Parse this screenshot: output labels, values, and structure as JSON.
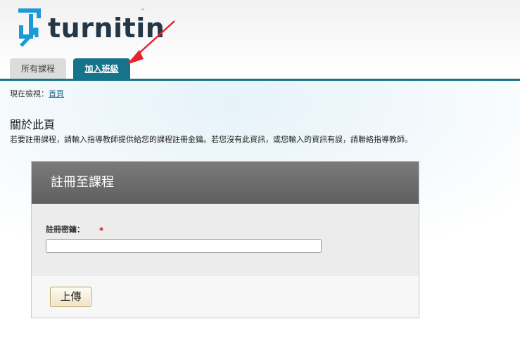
{
  "brand": {
    "logo_text": "turnitin",
    "trademark": "™",
    "primary_color": "#16748a",
    "logo_mark_color": "#1a9ad6"
  },
  "tabs": [
    {
      "label": "所有課程",
      "active": false
    },
    {
      "label": "加入班級",
      "active": true
    }
  ],
  "breadcrumb": {
    "prefix": "現在檢視：",
    "link": "首頁"
  },
  "about": {
    "title": "關於此頁",
    "description": "若要註冊課程，請輸入指導教師提供給您的課程註冊金鑰。若您沒有此資訊，或您輸入的資訊有誤，請聯絡指導教師。"
  },
  "form": {
    "title": "註冊至課程",
    "key_label": "註冊密鑰：",
    "required_marker": "*",
    "key_value": "",
    "submit_label": "上傳"
  },
  "annotation": {
    "arrow_color": "#e8242a"
  }
}
